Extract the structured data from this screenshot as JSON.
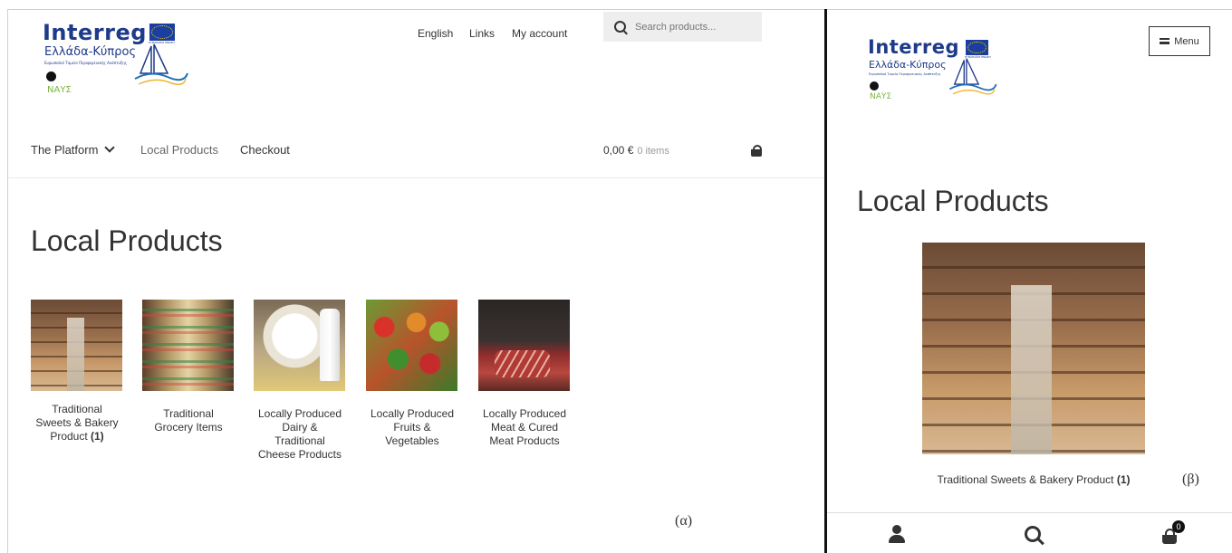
{
  "logo": {
    "word": "Interreg",
    "subtitle": "Ελλάδα-Κύπρος",
    "tagline": "Ευρωπαϊκό Ταμείο Περιφερειακής Ανάπτυξης",
    "eu_caption": "ΕΥΡΩΠΑΪΚΗ ΕΝΩΣΗ",
    "program": "ΝΑΥΣ"
  },
  "desktop": {
    "top_links": [
      "English",
      "Links",
      "My account"
    ],
    "search_placeholder": "Search products...",
    "nav": {
      "platform": "The Platform",
      "local_products": "Local Products",
      "checkout": "Checkout"
    },
    "cart": {
      "total": "0,00 €",
      "items": "0 items"
    },
    "page_title": "Local Products",
    "categories": [
      {
        "line1": "Traditional",
        "line2": "Sweets & Bakery",
        "line3": "Product",
        "count": "(1)"
      },
      {
        "line1": "Traditional",
        "line2": "Grocery Items"
      },
      {
        "line1": "Locally Produced",
        "line2": "Dairy &",
        "line3": "Traditional",
        "line4": "Cheese Products"
      },
      {
        "line1": "Locally Produced",
        "line2": "Fruits &",
        "line3": "Vegetables"
      },
      {
        "line1": "Locally Produced",
        "line2": "Meat & Cured",
        "line3": "Meat Products"
      }
    ],
    "figure_label": "(α)"
  },
  "mobile": {
    "menu_label": "Menu",
    "page_title": "Local Products",
    "category_label": "Traditional Sweets & Bakery Product",
    "category_count": "(1)",
    "figure_label": "(β)",
    "cart_count": "0"
  },
  "colors": {
    "brand_blue": "#1e3a8a",
    "eu_blue": "#1a3fa0",
    "accent_green": "#7cb342",
    "text": "#333333"
  }
}
